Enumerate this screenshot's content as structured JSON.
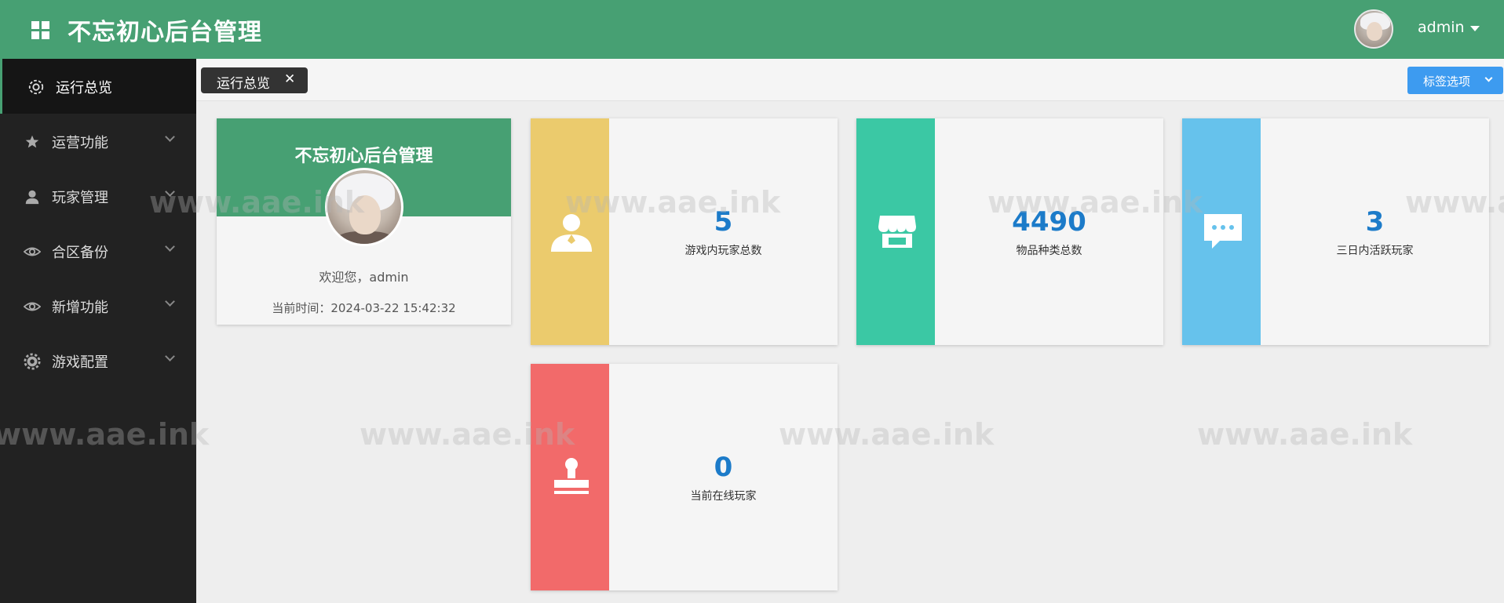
{
  "header": {
    "title": "不忘初心后台管理",
    "user_name": "admin"
  },
  "sidebar": {
    "items": [
      {
        "label": "运行总览",
        "icon": "gear-outline-icon",
        "active": true
      },
      {
        "label": "运营功能",
        "icon": "star-icon"
      },
      {
        "label": "玩家管理",
        "icon": "user-icon"
      },
      {
        "label": "合区备份",
        "icon": "eye-icon"
      },
      {
        "label": "新增功能",
        "icon": "eye-icon"
      },
      {
        "label": "游戏配置",
        "icon": "gear-icon"
      }
    ]
  },
  "tabs": {
    "items": [
      {
        "label": "运行总览",
        "close": "✕"
      }
    ],
    "options_label": "标签选项"
  },
  "profile": {
    "title": "不忘初心后台管理",
    "welcome": "欢迎您，admin",
    "time": "当前时间：2024-03-22 15:42:32"
  },
  "stats": [
    {
      "value": "5",
      "label": "游戏内玩家总数",
      "color": "#ebcb6d",
      "icon": "user-icon"
    },
    {
      "value": "4490",
      "label": "物品种类总数",
      "color": "#3bc8a4",
      "icon": "shop-icon"
    },
    {
      "value": "3",
      "label": "三日内活跃玩家",
      "color": "#66c2ec",
      "icon": "chat-icon"
    },
    {
      "value": "0",
      "label": "当前在线玩家",
      "color": "#f26a6a",
      "icon": "stamp-icon"
    }
  ],
  "watermark": "www.aae.ink",
  "colors": {
    "brand_green": "#47a073",
    "sidebar_bg": "#222222",
    "value_blue": "#1c7bc9",
    "options_blue": "#3d9bf0"
  }
}
